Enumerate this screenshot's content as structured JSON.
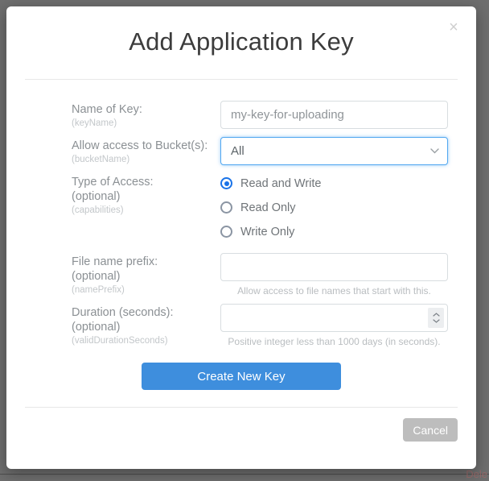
{
  "modal": {
    "title": "Add Application Key",
    "close_icon": "close-icon",
    "close_label": "×"
  },
  "form": {
    "rows": [
      {
        "label": "Name of Key:",
        "optional": "",
        "code": "(keyName)",
        "value": "my-key-for-uploading",
        "help": ""
      },
      {
        "label": "Allow access to Bucket(s):",
        "optional": "",
        "code": "(bucketName)",
        "value": "All",
        "help": ""
      },
      {
        "label": "Type of Access:",
        "optional": "(optional)",
        "code": "(capabilities)",
        "value": "",
        "help": ""
      },
      {
        "label": "File name prefix:",
        "optional": "(optional)",
        "code": "(namePrefix)",
        "value": "",
        "help": "Allow access to file names that start with this."
      },
      {
        "label": "Duration (seconds):",
        "optional": "(optional)",
        "code": "(validDurationSeconds)",
        "value": "",
        "help": "Positive integer less than 1000 days (in seconds)."
      }
    ],
    "bucket_options": [
      "All"
    ],
    "capabilities": [
      {
        "label": "Read and Write",
        "selected": true
      },
      {
        "label": "Read Only",
        "selected": false
      },
      {
        "label": "Write Only",
        "selected": false
      }
    ]
  },
  "actions": {
    "create_label": "Create New Key",
    "cancel_label": "Cancel"
  },
  "background": {
    "partial_text": "Dele"
  },
  "colors": {
    "accent": "#3e8edd",
    "radio_selected": "#1a73e8",
    "select_focus_border": "#51a7f0",
    "cancel_gray": "#bdbdbd",
    "label_gray": "#8b9094",
    "code_gray": "#c3c7ca",
    "overlay": "#6e6e6e"
  }
}
